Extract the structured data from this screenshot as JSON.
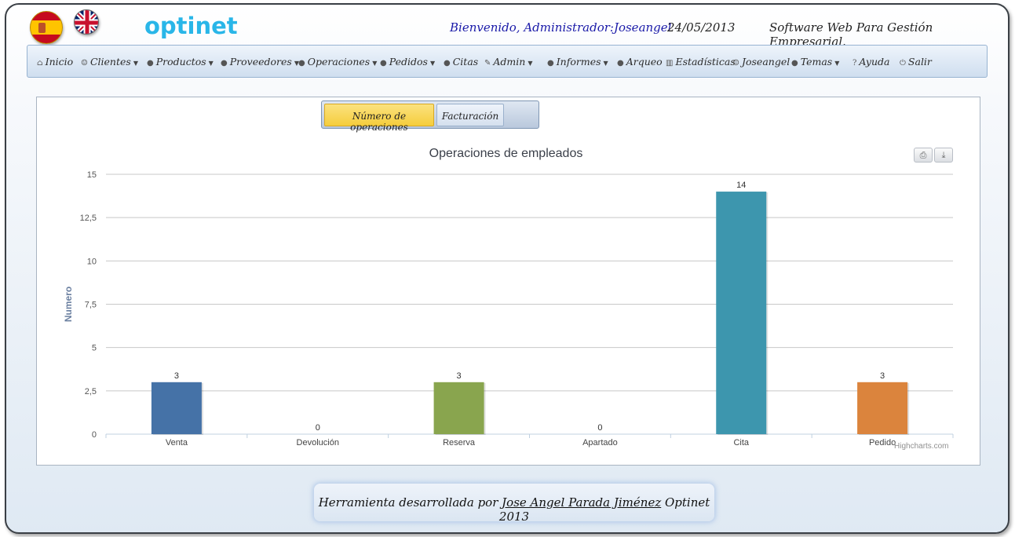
{
  "header": {
    "languages": [
      {
        "name": "spain-flag-icon",
        "label": "Español"
      },
      {
        "name": "uk-flag-icon",
        "label": "English"
      }
    ],
    "logo": "optinet",
    "welcome": "Bienvenido, Administrador:Joseangel",
    "date": "24/05/2013",
    "slogan": "Software Web Para Gestión Empresarial."
  },
  "menu": [
    {
      "label": "Inicio",
      "icon": "home-icon",
      "glyph": "⌂",
      "dropdown": false
    },
    {
      "label": "Clientes",
      "icon": "user-icon",
      "glyph": "☺",
      "dropdown": true
    },
    {
      "label": "Productos",
      "icon": "bullet-icon",
      "glyph": "●",
      "dropdown": true
    },
    {
      "label": "Proveedores",
      "icon": "bullet-icon",
      "glyph": "●",
      "dropdown": true
    },
    {
      "label": "Operaciones",
      "icon": "bullet-icon",
      "glyph": "●",
      "dropdown": true
    },
    {
      "label": "Pedidos",
      "icon": "bullet-icon",
      "glyph": "●",
      "dropdown": true
    },
    {
      "label": "Citas",
      "icon": "bullet-icon",
      "glyph": "●",
      "dropdown": false
    },
    {
      "label": "Admin",
      "icon": "wrench-icon",
      "glyph": "✎",
      "dropdown": true
    },
    {
      "label": "Informes",
      "icon": "bullet-icon",
      "glyph": "●",
      "dropdown": true
    },
    {
      "label": "Arqueo",
      "icon": "bullet-icon",
      "glyph": "●",
      "dropdown": false
    },
    {
      "label": "Estadísticas",
      "icon": "bar-chart-icon",
      "glyph": "▥",
      "dropdown": false
    },
    {
      "label": "Joseangel",
      "icon": "user-icon",
      "glyph": "☺",
      "dropdown": false
    },
    {
      "label": "Temas",
      "icon": "bullet-icon",
      "glyph": "●",
      "dropdown": true
    },
    {
      "label": "Ayuda",
      "icon": "help-icon",
      "glyph": "?",
      "dropdown": false
    },
    {
      "label": "Salir",
      "icon": "power-icon",
      "glyph": "⏻",
      "dropdown": false
    }
  ],
  "tabs": [
    {
      "label": "Número de operaciones",
      "active": true
    },
    {
      "label": "Facturación",
      "active": false
    }
  ],
  "chart_data": {
    "type": "bar",
    "title": "Operaciones de empleados",
    "ylabel": "Numero",
    "xlabel": "",
    "categories": [
      "Venta",
      "Devolución",
      "Reserva",
      "Apartado",
      "Cita",
      "Pedido"
    ],
    "values": [
      3,
      0,
      3,
      0,
      14,
      3
    ],
    "colors": [
      "#4572a7",
      "#aa4643",
      "#89a54e",
      "#80699b",
      "#3d96ae",
      "#db843d"
    ],
    "ylim": [
      0,
      15
    ],
    "yticks": [
      "0",
      "2,5",
      "5",
      "7,5",
      "10",
      "12,5",
      "15"
    ],
    "ytick_values": [
      0,
      2.5,
      5,
      7.5,
      10,
      12.5,
      15
    ],
    "grid": true,
    "data_labels": true,
    "legend": "none",
    "credits": "Highcharts.com",
    "buttons": [
      "print-icon",
      "download-icon"
    ]
  },
  "footer": {
    "prefix": "Herramienta desarrollada por ",
    "author": "Jose Angel Parada Jiménez",
    "suffix": " Optinet 2013"
  }
}
